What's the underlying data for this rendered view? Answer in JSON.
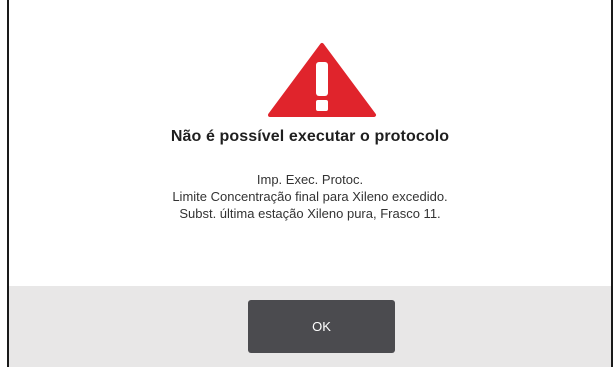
{
  "dialog": {
    "icon": "warning-icon",
    "icon_color": "#e0242c",
    "title": "Não é possível executar o protocolo",
    "message_lines": [
      "Imp. Exec. Protoc.",
      "Limite Concentração final para Xileno excedido.",
      "Subst. última estação Xileno pura, Frasco 11."
    ],
    "ok_label": "OK"
  }
}
